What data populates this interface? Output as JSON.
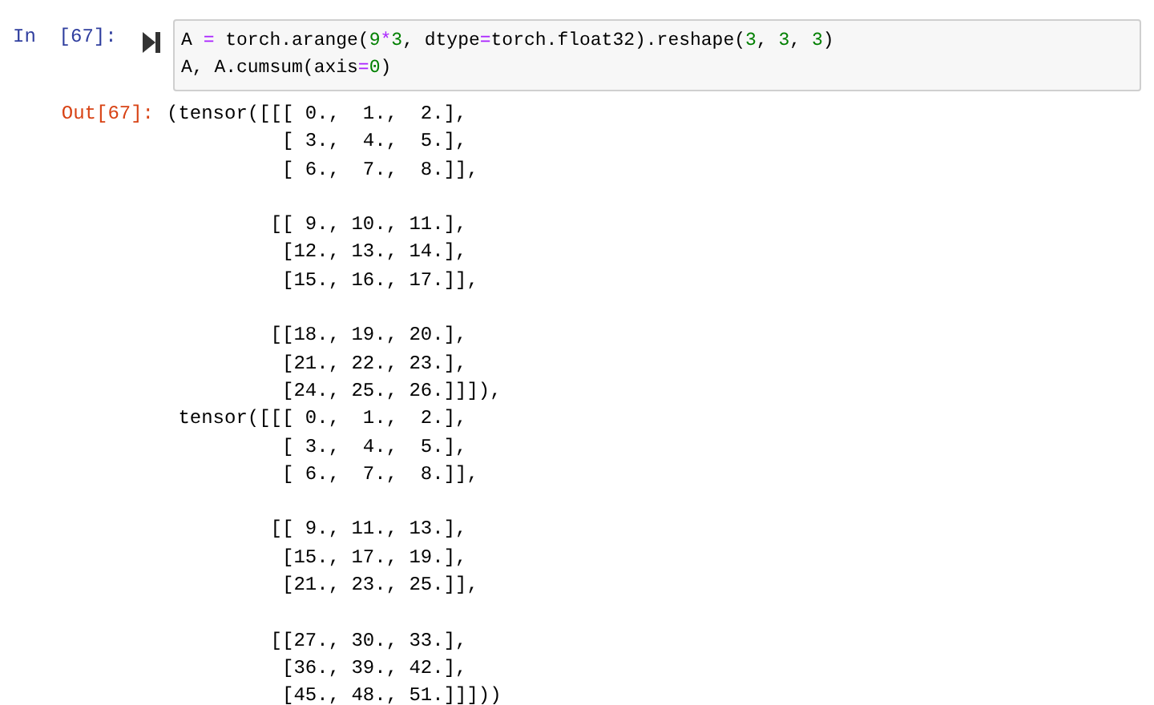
{
  "input_cell": {
    "prompt": "In  [67]:",
    "code_lines": [
      [
        {
          "kind": "name",
          "text": "A "
        },
        {
          "kind": "op",
          "text": "="
        },
        {
          "kind": "name",
          "text": " torch.arange("
        },
        {
          "kind": "number",
          "text": "9"
        },
        {
          "kind": "op",
          "text": "*"
        },
        {
          "kind": "number",
          "text": "3"
        },
        {
          "kind": "name",
          "text": ", dtype"
        },
        {
          "kind": "op",
          "text": "="
        },
        {
          "kind": "name",
          "text": "torch.float32).reshape("
        },
        {
          "kind": "number",
          "text": "3"
        },
        {
          "kind": "name",
          "text": ", "
        },
        {
          "kind": "number",
          "text": "3"
        },
        {
          "kind": "name",
          "text": ", "
        },
        {
          "kind": "number",
          "text": "3"
        },
        {
          "kind": "name",
          "text": ")"
        }
      ],
      [
        {
          "kind": "name",
          "text": "A, A.cumsum(axis"
        },
        {
          "kind": "op",
          "text": "="
        },
        {
          "kind": "number",
          "text": "0"
        },
        {
          "kind": "name",
          "text": ")"
        }
      ]
    ]
  },
  "output_cell": {
    "prompt": "Out[67]:",
    "text": "(tensor([[[ 0.,  1.,  2.],\n          [ 3.,  4.,  5.],\n          [ 6.,  7.,  8.]],\n\n         [[ 9., 10., 11.],\n          [12., 13., 14.],\n          [15., 16., 17.]],\n\n         [[18., 19., 20.],\n          [21., 22., 23.],\n          [24., 25., 26.]]]),\n tensor([[[ 0.,  1.,  2.],\n          [ 3.,  4.,  5.],\n          [ 6.,  7.,  8.]],\n\n         [[ 9., 11., 13.],\n          [15., 17., 19.],\n          [21., 23., 25.]],\n\n         [[27., 30., 33.],\n          [36., 39., 42.],\n          [45., 48., 51.]]]))"
  }
}
